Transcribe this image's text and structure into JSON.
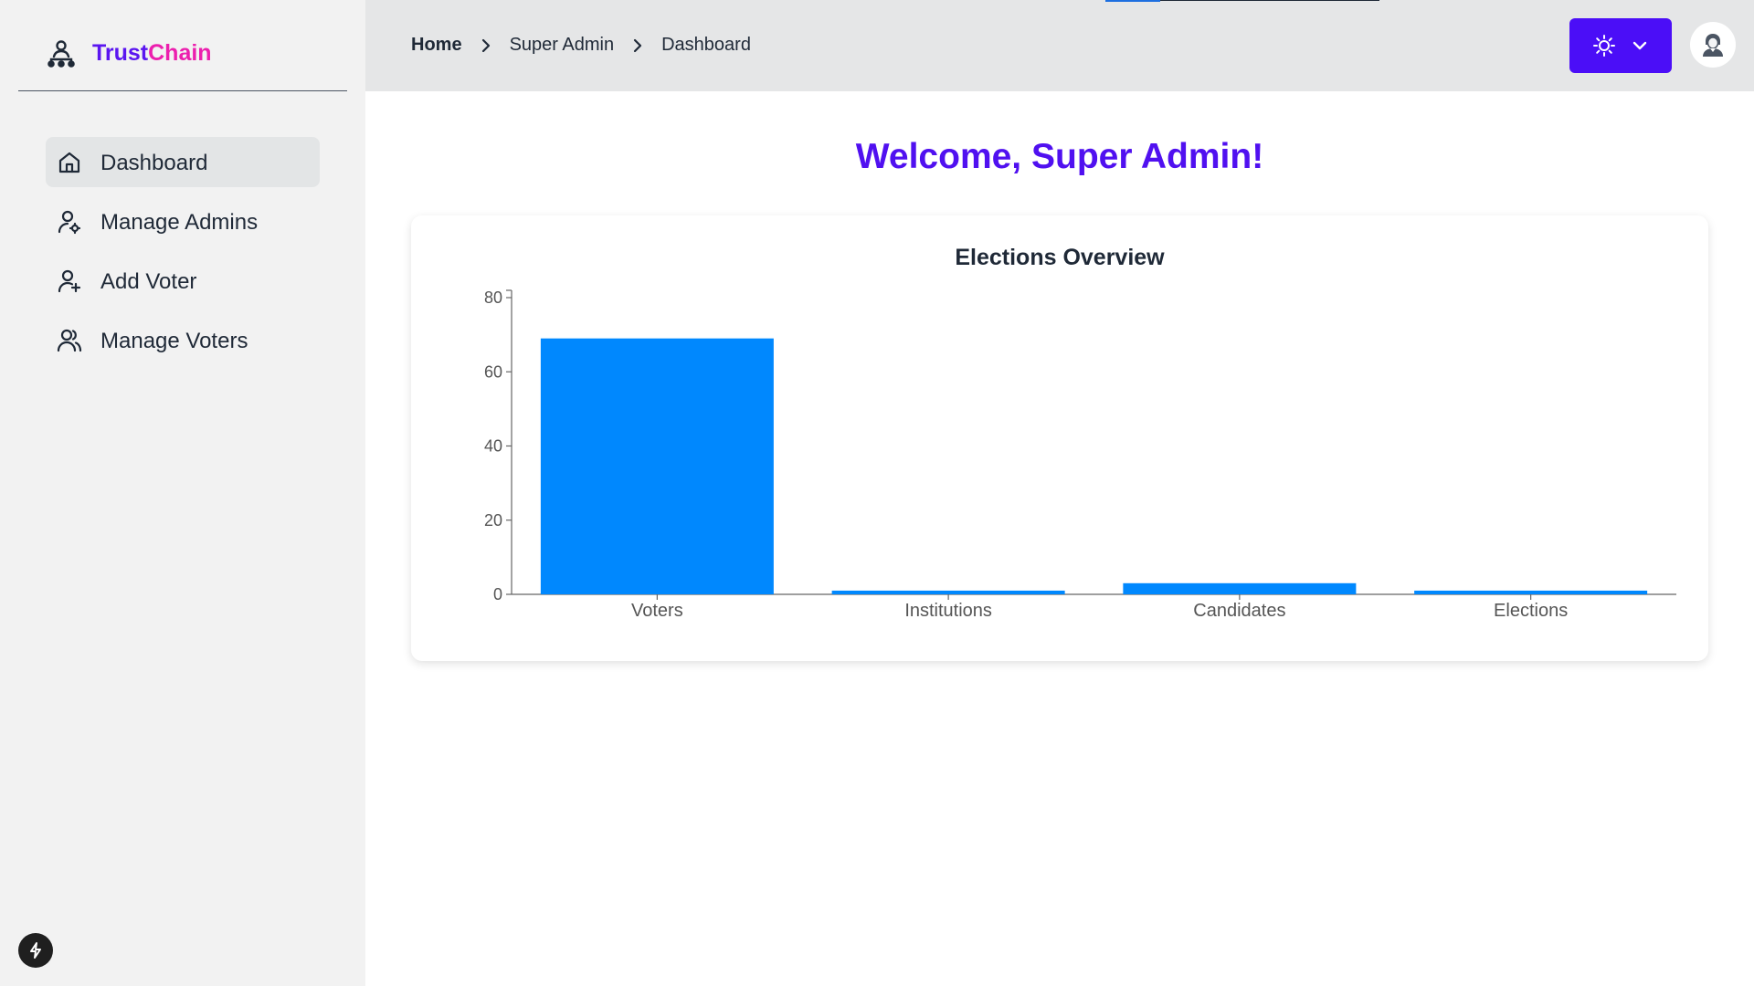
{
  "brand": {
    "part1": "Trust",
    "part2": "Chain",
    "icon": "org-chart-user-icon"
  },
  "sidebar": {
    "items": [
      {
        "label": "Dashboard",
        "icon": "home-icon",
        "active": true
      },
      {
        "label": "Manage Admins",
        "icon": "user-gear-icon",
        "active": false
      },
      {
        "label": "Add Voter",
        "icon": "user-plus-icon",
        "active": false
      },
      {
        "label": "Manage Voters",
        "icon": "users-icon",
        "active": false
      }
    ]
  },
  "header": {
    "breadcrumb": [
      "Home",
      "Super Admin",
      "Dashboard"
    ],
    "theme_icon": "sun-icon",
    "avatar_icon": "user-avatar-icon"
  },
  "main": {
    "welcome": "Welcome, Super Admin!"
  },
  "colors": {
    "accent": "#4b0ef7",
    "bar": "#0088fe",
    "brand_trust": "#5b16f0",
    "brand_chain": "#ec1fae"
  },
  "chart_data": {
    "type": "bar",
    "title": "Elections Overview",
    "categories": [
      "Voters",
      "Institutions",
      "Candidates",
      "Elections"
    ],
    "values": [
      69,
      1,
      3,
      1
    ],
    "yticks": [
      0,
      20,
      40,
      60,
      80
    ],
    "ylim": [
      0,
      80
    ],
    "xlabel": "",
    "ylabel": "",
    "grid": false,
    "legend": "none"
  }
}
